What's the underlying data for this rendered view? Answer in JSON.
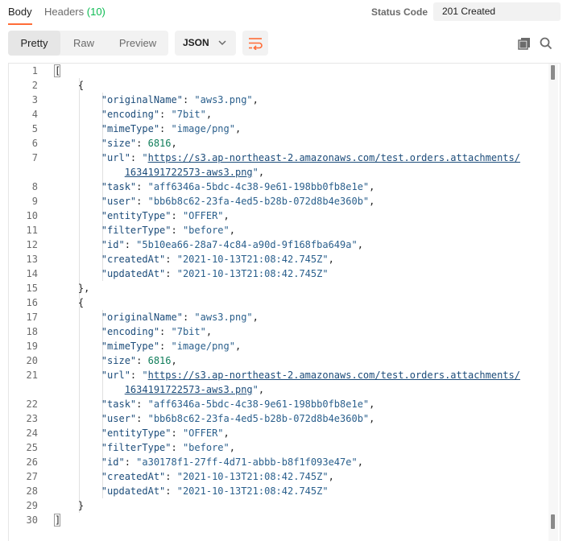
{
  "tabs": {
    "body": "Body",
    "headers": "Headers",
    "headers_count": "(10)"
  },
  "status": {
    "label": "Status Code",
    "value": "201 Created"
  },
  "toolbar": {
    "pretty": "Pretty",
    "raw": "Raw",
    "preview": "Preview",
    "format": "JSON"
  },
  "colors": {
    "accent": "#ff6c37",
    "headers_count": "#0cbb52",
    "key": "#1c4c7a",
    "number": "#0f7d5a"
  },
  "icons": {
    "format_chevron": "chevron-down-icon",
    "wrap": "text-wrap-icon",
    "copy": "copy-icon",
    "search": "search-icon"
  },
  "code_lines": [
    {
      "num": "1",
      "tokens": [
        {
          "t": "p",
          "v": "["
        }
      ]
    },
    {
      "num": "2",
      "tokens": [
        {
          "t": "p",
          "v": "    {"
        }
      ]
    },
    {
      "num": "3",
      "tokens": [
        {
          "t": "p",
          "v": "        "
        },
        {
          "t": "k",
          "v": "\"originalName\""
        },
        {
          "t": "p",
          "v": ": "
        },
        {
          "t": "s",
          "v": "\"aws3.png\""
        },
        {
          "t": "p",
          "v": ","
        }
      ]
    },
    {
      "num": "4",
      "tokens": [
        {
          "t": "p",
          "v": "        "
        },
        {
          "t": "k",
          "v": "\"encoding\""
        },
        {
          "t": "p",
          "v": ": "
        },
        {
          "t": "s",
          "v": "\"7bit\""
        },
        {
          "t": "p",
          "v": ","
        }
      ]
    },
    {
      "num": "5",
      "tokens": [
        {
          "t": "p",
          "v": "        "
        },
        {
          "t": "k",
          "v": "\"mimeType\""
        },
        {
          "t": "p",
          "v": ": "
        },
        {
          "t": "s",
          "v": "\"image/png\""
        },
        {
          "t": "p",
          "v": ","
        }
      ]
    },
    {
      "num": "6",
      "tokens": [
        {
          "t": "p",
          "v": "        "
        },
        {
          "t": "k",
          "v": "\"size\""
        },
        {
          "t": "p",
          "v": ": "
        },
        {
          "t": "n",
          "v": "6816"
        },
        {
          "t": "p",
          "v": ","
        }
      ]
    },
    {
      "num": "7",
      "tokens": [
        {
          "t": "p",
          "v": "        "
        },
        {
          "t": "k",
          "v": "\"url\""
        },
        {
          "t": "p",
          "v": ": "
        },
        {
          "t": "s",
          "v": "\""
        },
        {
          "t": "u",
          "v": "https://s3.ap-northeast-2.amazonaws.com/test.orders.attachments/"
        }
      ]
    },
    {
      "num": "",
      "tokens": [
        {
          "t": "p",
          "v": "            "
        },
        {
          "t": "u",
          "v": "1634191722573-aws3.png"
        },
        {
          "t": "s",
          "v": "\""
        },
        {
          "t": "p",
          "v": ","
        }
      ]
    },
    {
      "num": "8",
      "tokens": [
        {
          "t": "p",
          "v": "        "
        },
        {
          "t": "k",
          "v": "\"task\""
        },
        {
          "t": "p",
          "v": ": "
        },
        {
          "t": "s",
          "v": "\"aff6346a-5bdc-4c38-9e61-198bb0fb8e1e\""
        },
        {
          "t": "p",
          "v": ","
        }
      ]
    },
    {
      "num": "9",
      "tokens": [
        {
          "t": "p",
          "v": "        "
        },
        {
          "t": "k",
          "v": "\"user\""
        },
        {
          "t": "p",
          "v": ": "
        },
        {
          "t": "s",
          "v": "\"bb6b8c62-23fa-4ed5-b28b-072d8b4e360b\""
        },
        {
          "t": "p",
          "v": ","
        }
      ]
    },
    {
      "num": "10",
      "tokens": [
        {
          "t": "p",
          "v": "        "
        },
        {
          "t": "k",
          "v": "\"entityType\""
        },
        {
          "t": "p",
          "v": ": "
        },
        {
          "t": "s",
          "v": "\"OFFER\""
        },
        {
          "t": "p",
          "v": ","
        }
      ]
    },
    {
      "num": "11",
      "tokens": [
        {
          "t": "p",
          "v": "        "
        },
        {
          "t": "k",
          "v": "\"filterType\""
        },
        {
          "t": "p",
          "v": ": "
        },
        {
          "t": "s",
          "v": "\"before\""
        },
        {
          "t": "p",
          "v": ","
        }
      ]
    },
    {
      "num": "12",
      "tokens": [
        {
          "t": "p",
          "v": "        "
        },
        {
          "t": "k",
          "v": "\"id\""
        },
        {
          "t": "p",
          "v": ": "
        },
        {
          "t": "s",
          "v": "\"5b10ea66-28a7-4c84-a90d-9f168fba649a\""
        },
        {
          "t": "p",
          "v": ","
        }
      ]
    },
    {
      "num": "13",
      "tokens": [
        {
          "t": "p",
          "v": "        "
        },
        {
          "t": "k",
          "v": "\"createdAt\""
        },
        {
          "t": "p",
          "v": ": "
        },
        {
          "t": "s",
          "v": "\"2021-10-13T21:08:42.745Z\""
        },
        {
          "t": "p",
          "v": ","
        }
      ]
    },
    {
      "num": "14",
      "tokens": [
        {
          "t": "p",
          "v": "        "
        },
        {
          "t": "k",
          "v": "\"updatedAt\""
        },
        {
          "t": "p",
          "v": ": "
        },
        {
          "t": "s",
          "v": "\"2021-10-13T21:08:42.745Z\""
        }
      ]
    },
    {
      "num": "15",
      "tokens": [
        {
          "t": "p",
          "v": "    },"
        }
      ]
    },
    {
      "num": "16",
      "tokens": [
        {
          "t": "p",
          "v": "    {"
        }
      ]
    },
    {
      "num": "17",
      "tokens": [
        {
          "t": "p",
          "v": "        "
        },
        {
          "t": "k",
          "v": "\"originalName\""
        },
        {
          "t": "p",
          "v": ": "
        },
        {
          "t": "s",
          "v": "\"aws3.png\""
        },
        {
          "t": "p",
          "v": ","
        }
      ]
    },
    {
      "num": "18",
      "tokens": [
        {
          "t": "p",
          "v": "        "
        },
        {
          "t": "k",
          "v": "\"encoding\""
        },
        {
          "t": "p",
          "v": ": "
        },
        {
          "t": "s",
          "v": "\"7bit\""
        },
        {
          "t": "p",
          "v": ","
        }
      ]
    },
    {
      "num": "19",
      "tokens": [
        {
          "t": "p",
          "v": "        "
        },
        {
          "t": "k",
          "v": "\"mimeType\""
        },
        {
          "t": "p",
          "v": ": "
        },
        {
          "t": "s",
          "v": "\"image/png\""
        },
        {
          "t": "p",
          "v": ","
        }
      ]
    },
    {
      "num": "20",
      "tokens": [
        {
          "t": "p",
          "v": "        "
        },
        {
          "t": "k",
          "v": "\"size\""
        },
        {
          "t": "p",
          "v": ": "
        },
        {
          "t": "n",
          "v": "6816"
        },
        {
          "t": "p",
          "v": ","
        }
      ]
    },
    {
      "num": "21",
      "tokens": [
        {
          "t": "p",
          "v": "        "
        },
        {
          "t": "k",
          "v": "\"url\""
        },
        {
          "t": "p",
          "v": ": "
        },
        {
          "t": "s",
          "v": "\""
        },
        {
          "t": "u",
          "v": "https://s3.ap-northeast-2.amazonaws.com/test.orders.attachments/"
        }
      ]
    },
    {
      "num": "",
      "tokens": [
        {
          "t": "p",
          "v": "            "
        },
        {
          "t": "u",
          "v": "1634191722573-aws3.png"
        },
        {
          "t": "s",
          "v": "\""
        },
        {
          "t": "p",
          "v": ","
        }
      ]
    },
    {
      "num": "22",
      "tokens": [
        {
          "t": "p",
          "v": "        "
        },
        {
          "t": "k",
          "v": "\"task\""
        },
        {
          "t": "p",
          "v": ": "
        },
        {
          "t": "s",
          "v": "\"aff6346a-5bdc-4c38-9e61-198bb0fb8e1e\""
        },
        {
          "t": "p",
          "v": ","
        }
      ]
    },
    {
      "num": "23",
      "tokens": [
        {
          "t": "p",
          "v": "        "
        },
        {
          "t": "k",
          "v": "\"user\""
        },
        {
          "t": "p",
          "v": ": "
        },
        {
          "t": "s",
          "v": "\"bb6b8c62-23fa-4ed5-b28b-072d8b4e360b\""
        },
        {
          "t": "p",
          "v": ","
        }
      ]
    },
    {
      "num": "24",
      "tokens": [
        {
          "t": "p",
          "v": "        "
        },
        {
          "t": "k",
          "v": "\"entityType\""
        },
        {
          "t": "p",
          "v": ": "
        },
        {
          "t": "s",
          "v": "\"OFFER\""
        },
        {
          "t": "p",
          "v": ","
        }
      ]
    },
    {
      "num": "25",
      "tokens": [
        {
          "t": "p",
          "v": "        "
        },
        {
          "t": "k",
          "v": "\"filterType\""
        },
        {
          "t": "p",
          "v": ": "
        },
        {
          "t": "s",
          "v": "\"before\""
        },
        {
          "t": "p",
          "v": ","
        }
      ]
    },
    {
      "num": "26",
      "tokens": [
        {
          "t": "p",
          "v": "        "
        },
        {
          "t": "k",
          "v": "\"id\""
        },
        {
          "t": "p",
          "v": ": "
        },
        {
          "t": "s",
          "v": "\"a30178f1-27ff-4d71-abbb-b8f1f093e47e\""
        },
        {
          "t": "p",
          "v": ","
        }
      ]
    },
    {
      "num": "27",
      "tokens": [
        {
          "t": "p",
          "v": "        "
        },
        {
          "t": "k",
          "v": "\"createdAt\""
        },
        {
          "t": "p",
          "v": ": "
        },
        {
          "t": "s",
          "v": "\"2021-10-13T21:08:42.745Z\""
        },
        {
          "t": "p",
          "v": ","
        }
      ]
    },
    {
      "num": "28",
      "tokens": [
        {
          "t": "p",
          "v": "        "
        },
        {
          "t": "k",
          "v": "\"updatedAt\""
        },
        {
          "t": "p",
          "v": ": "
        },
        {
          "t": "s",
          "v": "\"2021-10-13T21:08:42.745Z\""
        }
      ]
    },
    {
      "num": "29",
      "tokens": [
        {
          "t": "p",
          "v": "    }"
        }
      ]
    },
    {
      "num": "30",
      "tokens": [
        {
          "t": "p",
          "v": "]"
        }
      ]
    }
  ]
}
